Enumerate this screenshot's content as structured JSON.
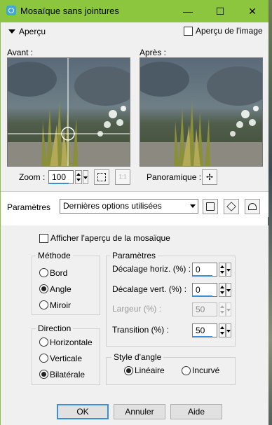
{
  "window": {
    "title": "Mosaïque sans jointures",
    "minimize": "—",
    "maximize": "☐",
    "close": "✕"
  },
  "preview": {
    "section_label": "Aperçu",
    "show_image_label": "Aperçu de l'image",
    "before_label": "Avant :",
    "after_label": "Après :",
    "zoom_label": "Zoom :",
    "zoom_value": "100",
    "zoom_fit_label": "1:1",
    "pan_label": "Panoramique :",
    "pan_icon": "✢"
  },
  "presets": {
    "label": "Paramètres",
    "selected": "Dernières options utilisées"
  },
  "options": {
    "show_tile_preview_label": "Afficher l'aperçu de la mosaïque",
    "method": {
      "title": "Méthode",
      "options": [
        "Bord",
        "Angle",
        "Miroir"
      ],
      "selected": "Angle"
    },
    "direction": {
      "title": "Direction",
      "options": [
        "Horizontale",
        "Verticale",
        "Bilatérale"
      ],
      "selected": "Bilatérale"
    },
    "params": {
      "title": "Paramètres",
      "h_offset_label": "Décalage horiz. (%) :",
      "h_offset_value": "0",
      "v_offset_label": "Décalage vert. (%) :",
      "v_offset_value": "0",
      "width_label": "Largeur (%) :",
      "width_value": "50",
      "transition_label": "Transition (%) :",
      "transition_value": "50"
    },
    "corner_style": {
      "title": "Style d'angle",
      "options": [
        "Linéaire",
        "Incurvé"
      ],
      "selected": "Linéaire"
    }
  },
  "buttons": {
    "ok": "OK",
    "cancel": "Annuler",
    "help": "Aide"
  },
  "colors": {
    "titlebar": "#8cc63f",
    "accent": "#3b8fd8",
    "panel": "#f0f0f0"
  }
}
